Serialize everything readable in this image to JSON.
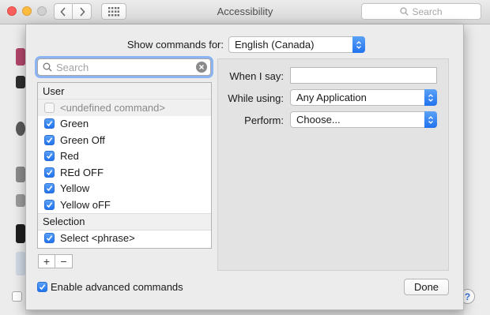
{
  "window": {
    "title": "Accessibility",
    "search_placeholder": "Search",
    "help_label": "?"
  },
  "sheet": {
    "show_commands_label": "Show commands for:",
    "language_value": "English (Canada)",
    "search_placeholder": "Search",
    "groups": [
      {
        "name": "User",
        "items": [
          {
            "label": "<undefined command>",
            "checked": false,
            "disabled": true
          },
          {
            "label": "Green",
            "checked": true
          },
          {
            "label": "Green Off",
            "checked": true
          },
          {
            "label": "Red",
            "checked": true
          },
          {
            "label": "REd OFF",
            "checked": true
          },
          {
            "label": "Yellow",
            "checked": true
          },
          {
            "label": "Yellow oFF",
            "checked": true
          }
        ]
      },
      {
        "name": "Selection",
        "items": [
          {
            "label": "Select <phrase>",
            "checked": true
          }
        ]
      }
    ],
    "add_label": "+",
    "remove_label": "−",
    "detail": {
      "when_i_say_label": "When I say:",
      "when_i_say_value": "",
      "while_using_label": "While using:",
      "while_using_value": "Any Application",
      "perform_label": "Perform:",
      "perform_value": "Choose..."
    },
    "enable_advanced_label": "Enable advanced commands",
    "enable_advanced_checked": true,
    "done_label": "Done"
  },
  "colors": {
    "accent": "#2173ee",
    "focus_ring": "#8cb4f3"
  }
}
